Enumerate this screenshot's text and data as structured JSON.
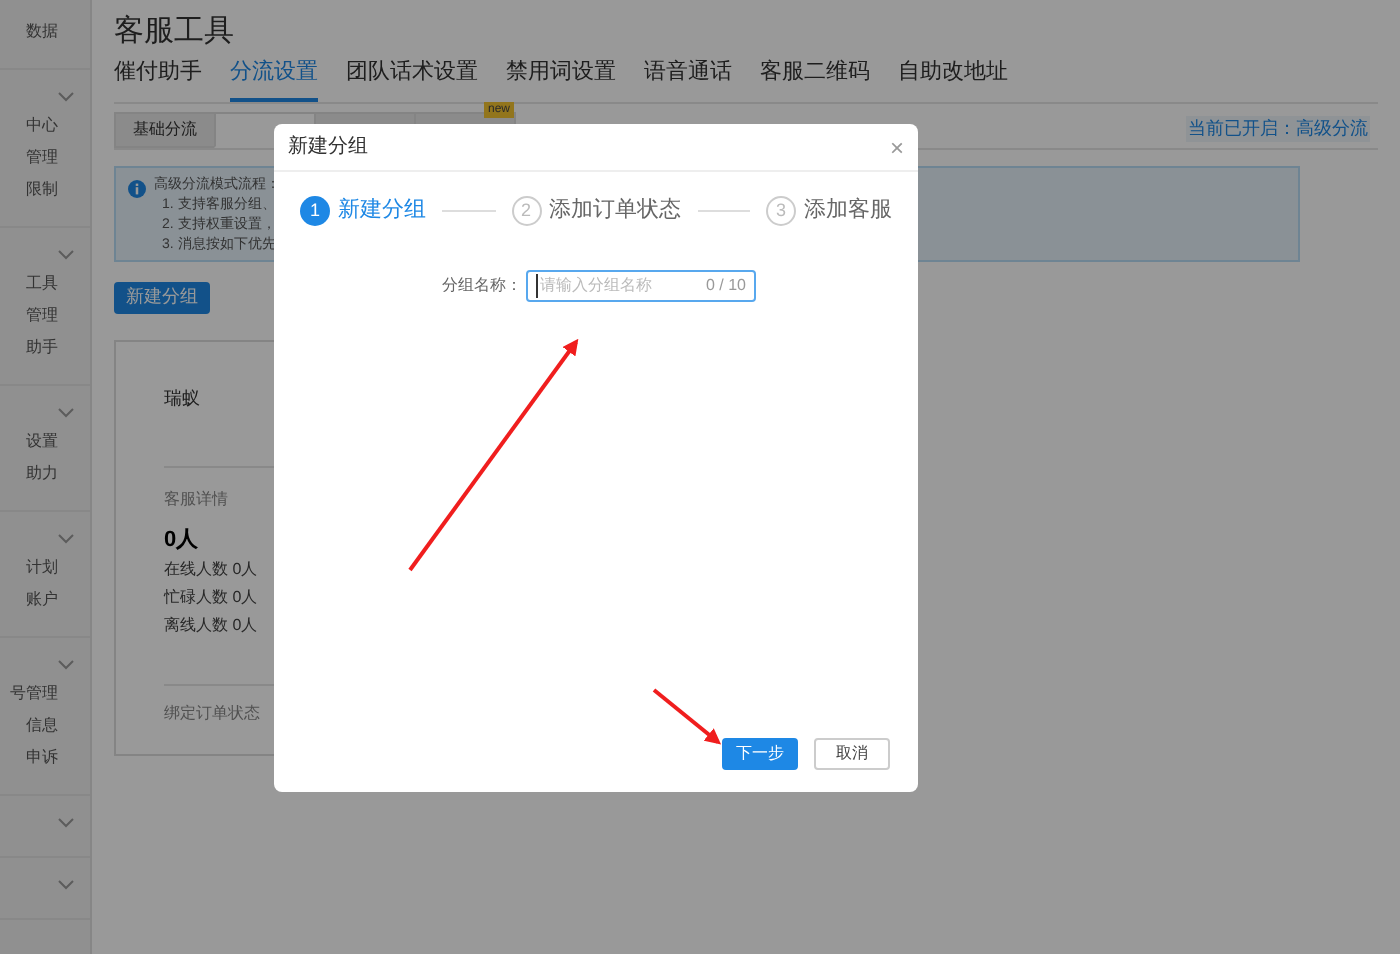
{
  "sidebar": {
    "sections": [
      {
        "kind": "group",
        "items": [
          "数据"
        ]
      },
      {
        "kind": "group",
        "items": [
          "中心",
          "管理",
          "限制"
        ]
      },
      {
        "kind": "group",
        "items": [
          "工具",
          "管理",
          "助手"
        ]
      },
      {
        "kind": "group",
        "items": [
          "设置",
          "助力"
        ]
      },
      {
        "kind": "group",
        "items": [
          "计划",
          "账户"
        ]
      },
      {
        "kind": "group",
        "items": [
          "号管理",
          "信息",
          "申诉"
        ]
      },
      {
        "kind": "collapsed"
      },
      {
        "kind": "collapsed"
      }
    ]
  },
  "page": {
    "title": "客服工具",
    "tabs": [
      {
        "label": "催付助手",
        "selected": false
      },
      {
        "label": "分流设置",
        "selected": true
      },
      {
        "label": "团队话术设置",
        "selected": false
      },
      {
        "label": "禁用词设置",
        "selected": false
      },
      {
        "label": "语音通话",
        "selected": false
      },
      {
        "label": "客服二维码",
        "selected": false
      },
      {
        "label": "自助改地址",
        "selected": false
      }
    ],
    "subtabs": [
      {
        "label": "基础分流",
        "selected": false
      },
      {
        "selected": true
      },
      {
        "selected": false
      },
      {
        "selected": false,
        "badge": "new"
      }
    ],
    "current_mode": "当前已开启：高级分流",
    "notice": {
      "title": "高级分流模式流程：",
      "lines": [
        "1. 支持客服分组、",
        "2. 支持权重设置，",
        "3. 消息按如下优先"
      ]
    },
    "new_group_button": "新建分组",
    "group_card": {
      "name": "瑞蚁",
      "details_label": "客服详情",
      "total": "0人",
      "stats": [
        "在线人数 0人",
        "忙碌人数 0人",
        "离线人数 0人"
      ],
      "order_status_label": "绑定订单状态"
    }
  },
  "dialog": {
    "title": "新建分组",
    "close": "×",
    "steps": [
      {
        "number": "1",
        "label": "新建分组",
        "active": true
      },
      {
        "number": "2",
        "label": "添加订单状态",
        "active": false
      },
      {
        "number": "3",
        "label": "添加客服",
        "active": false
      }
    ],
    "field": {
      "label": "分组名称：",
      "placeholder": "请输入分组名称",
      "counter": "0 / 10"
    },
    "buttons": [
      {
        "label": "下一步",
        "kind": "primary"
      },
      {
        "label": "取消",
        "kind": "default"
      }
    ]
  }
}
